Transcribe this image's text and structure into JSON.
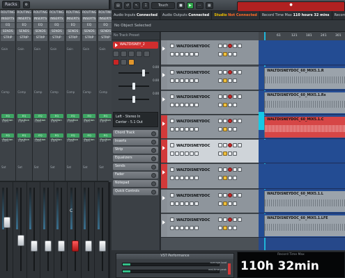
{
  "toolbar": {
    "racks_label": "Racks",
    "touch_label": "Touch",
    "transport": {
      "stop": "■",
      "play": "▶",
      "record": "●"
    }
  },
  "mixer": {
    "rows": {
      "routing": "ROUTING",
      "inserts": "INSERTS",
      "eq": "EQ",
      "sends": "SENDS",
      "strip": "STRIP",
      "gain": "Gain",
      "comp": "Comp",
      "eq_position": "EQ Position",
      "trans": "Trans",
      "sat": "Sat"
    },
    "channels": 8,
    "fader_mark": "C"
  },
  "status": {
    "audio_inputs_label": "Audio Inputs",
    "audio_inputs_value": "Connected",
    "audio_outputs_label": "Audio Outputs",
    "audio_outputs_value": "Connected",
    "studio_label": "Studio",
    "studio_value": "Not Connected",
    "record_time_label": "Record Time Max",
    "record_time_value": "110 hours 32 mins",
    "record_format_label": "Record Format"
  },
  "selection_bar": {
    "text": "No Object Selected"
  },
  "inspector": {
    "header": "No Track Preset",
    "track_name": "WALTDISNEY_2",
    "volume_value": "0.00",
    "pan_value": "0.00",
    "delay_value": "0.00",
    "input_routing": "Left - Stereo In",
    "output_routing": "Center - 5.1 Out",
    "sections": [
      "Chord Track",
      "Inserts",
      "Strip",
      "Equalizers",
      "Sends",
      "Fader",
      "Notepad",
      "Quick Controls"
    ]
  },
  "tracks": [
    {
      "name": "WALTDISNEYDOC",
      "event": "",
      "red": false,
      "selected": false
    },
    {
      "name": "WALTDISNEYDOC",
      "event": "WALTDISNEYDOC_60_MIX5.1.R",
      "red": false,
      "selected": false
    },
    {
      "name": "WALTDISNEYDOC",
      "event": "WALTDISNEYDOC_60_MIX5.1.Rs",
      "red": false,
      "selected": false
    },
    {
      "name": "WALTDISNEYDOC",
      "event": "WALTDISNEYDOC_60_MIX5.1.C",
      "red": true,
      "selected": false
    },
    {
      "name": "WALTDISNEYDOC",
      "event": "",
      "red": true,
      "selected": true
    },
    {
      "name": "WALTDISNEYDOC",
      "event": "",
      "red": true,
      "selected": false
    },
    {
      "name": "WALTDISNEYDOC",
      "event": "WALTDISNEYDOC_60_MIX5.1.L",
      "red": false,
      "selected": false
    },
    {
      "name": "WALTDISNEYDOC",
      "event": "WALTDISNEYDOC_60_MIX5.1.LFE",
      "red": false,
      "selected": false
    }
  ],
  "ruler": {
    "marks": [
      "61",
      "121",
      "181",
      "241",
      "301"
    ]
  },
  "vst": {
    "title": "VST Performance",
    "average_load_label": "average load",
    "realtime_peak_label": "real-time peak",
    "average_load": 0.08,
    "realtime_peak": 0.08
  },
  "record_time": {
    "title": "Record Time Max",
    "value": "110h 32min"
  },
  "colors": {
    "accent_blue": "#26488a",
    "track_red": "#d23a3a",
    "play_green": "#2fa64a",
    "warn_orange": "#ff6d2a",
    "cyan": "#1fb5d9"
  }
}
